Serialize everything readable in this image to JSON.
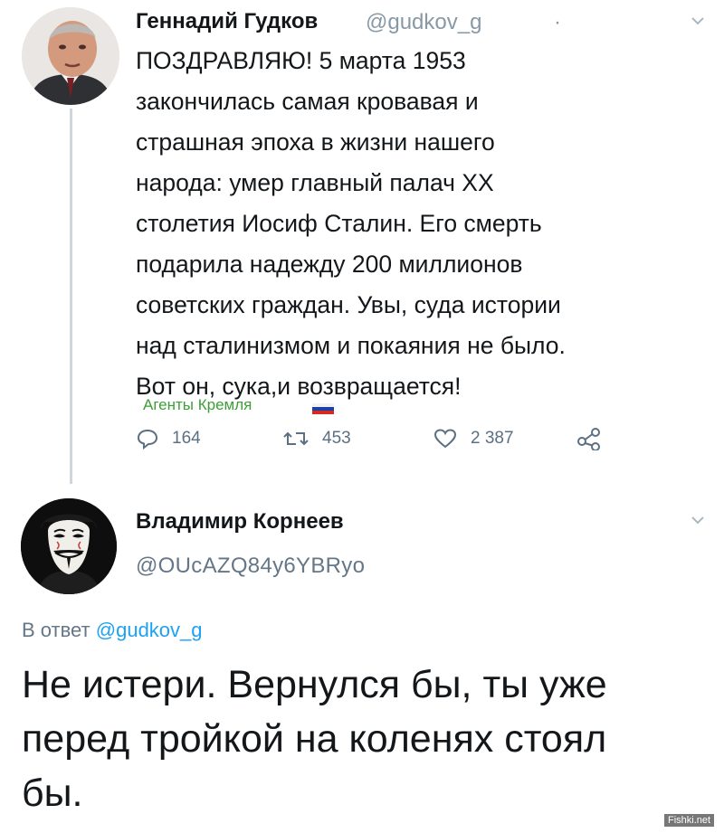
{
  "tweet1": {
    "author_name": "Геннадий Гудков",
    "author_handle": "@gudkov_g",
    "separator": "·",
    "text_lines": [
      "ПОЗДРАВЛЯЮ! 5 марта 1953",
      "закончилась самая кровавая и",
      "страшная эпоха в жизни нашего",
      "народа: умер главный палач XX",
      "столетия Иосиф Сталин. Его смерть",
      "подарила надежду 200 миллионов",
      "советских граждан. Увы, суда истории",
      "над сталинизмом и покаяния не было.",
      "Вот он, сука,и возвращается!"
    ],
    "stats": {
      "replies": "164",
      "retweets": "453",
      "likes": "2 387"
    },
    "icons": [
      "reply-icon",
      "retweet-icon",
      "like-icon",
      "share-icon",
      "chevron-down-icon"
    ]
  },
  "watermark": {
    "text": "Агенты Кремля",
    "flag_colors": [
      "#ffffff",
      "#1c3fa8",
      "#d52b1e"
    ]
  },
  "tweet2": {
    "author_name": "Владимир Корнеев",
    "author_handle": "@OUcAZQ84y6YBRyo",
    "reply_prefix": "В ответ",
    "reply_handle": "@gudkov_g",
    "text_lines": [
      "Не истери. Вернулся бы, ты уже",
      "перед тройкой на коленях стоял",
      "бы."
    ]
  },
  "site_tag": "Fishki.net",
  "colors": {
    "text": "#14171a",
    "muted": "#8899a6",
    "link": "#1da1f2",
    "thread_line": "#cfd6dc",
    "watermark": "#3d9e38"
  }
}
